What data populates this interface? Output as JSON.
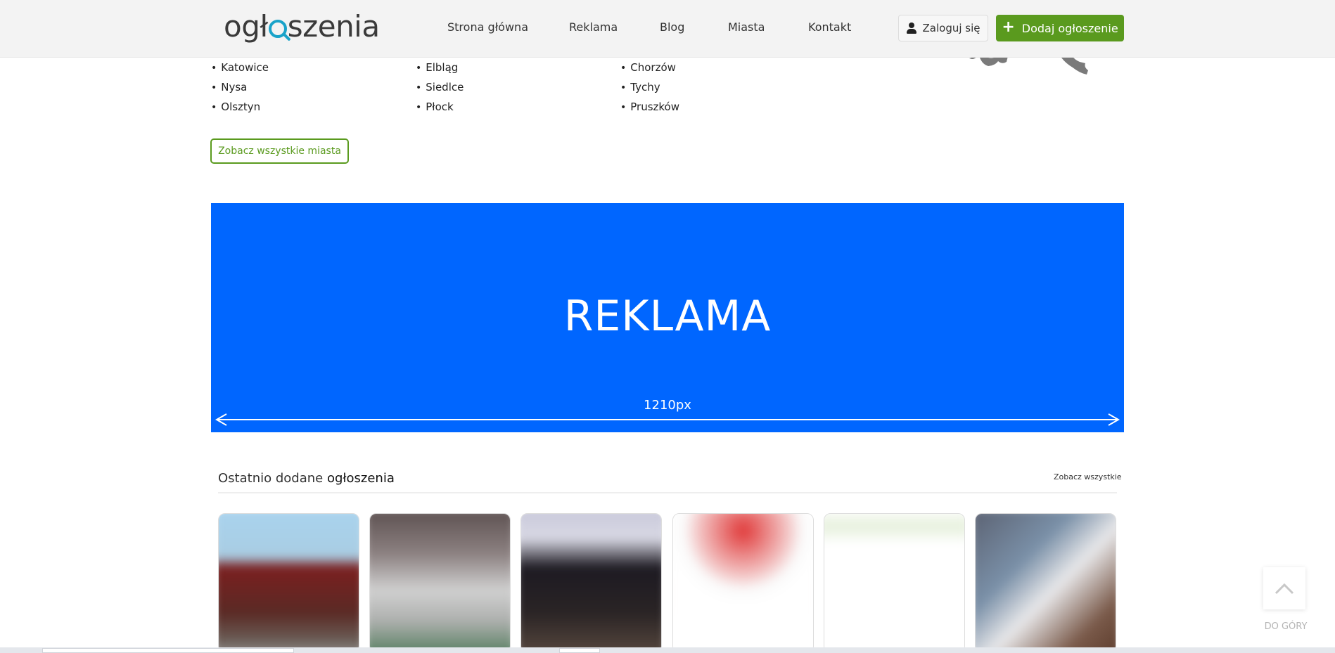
{
  "header": {
    "logo_pre": "ogł",
    "logo_post": "szenia",
    "nav": [
      {
        "label": "Strona główna"
      },
      {
        "label": "Reklama"
      },
      {
        "label": "Blog"
      },
      {
        "label": "Miasta"
      },
      {
        "label": "Kontakt"
      }
    ],
    "login_label": "Zaloguj się",
    "add_label": "Dodaj ogłoszenie"
  },
  "cities": {
    "col1": [
      "Katowice",
      "Nysa",
      "Olsztyn"
    ],
    "col2": [
      "Elbląg",
      "Siedlce",
      "Płock"
    ],
    "col3": [
      "Chorzów",
      "Tychy",
      "Pruszków"
    ],
    "all_label": "Zobacz wszystkie miasta"
  },
  "ad": {
    "title": "REKLAMA",
    "width_label": "1210px",
    "color": "#0066ff"
  },
  "recent": {
    "title_pre": "Ostatnio dodane ",
    "title_bold": "ogłoszenia",
    "see_all_label": "Zobacz wszystkie"
  },
  "back_to_top": {
    "label": "DO GÓRY"
  },
  "colors": {
    "accent": "#5a9a1e",
    "logo_lens": "#1aa3c9"
  }
}
